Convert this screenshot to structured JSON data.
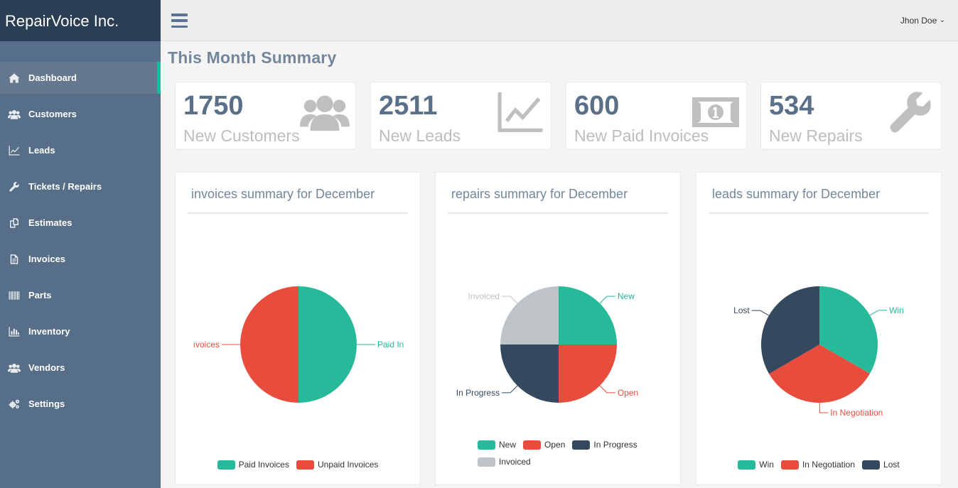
{
  "brand": "RepairVoice Inc.",
  "user": {
    "name": "Jhon Doe",
    "caret": "⌄"
  },
  "sidebar": {
    "items": [
      {
        "label": "Dashboard",
        "icon": "home-icon"
      },
      {
        "label": "Customers",
        "icon": "users-icon"
      },
      {
        "label": "Leads",
        "icon": "line-chart-icon"
      },
      {
        "label": "Tickets / Repairs",
        "icon": "wrench-icon"
      },
      {
        "label": "Estimates",
        "icon": "copy-icon"
      },
      {
        "label": "Invoices",
        "icon": "file-text-icon"
      },
      {
        "label": "Parts",
        "icon": "barcode-icon"
      },
      {
        "label": "Inventory",
        "icon": "bar-chart-icon"
      },
      {
        "label": "Vendors",
        "icon": "users-icon"
      },
      {
        "label": "Settings",
        "icon": "cogs-icon"
      }
    ]
  },
  "page": {
    "title": "This Month Summary"
  },
  "tiles": [
    {
      "count": "1750",
      "label": "New Customers",
      "icon": "users-icon"
    },
    {
      "count": "2511",
      "label": "New Leads",
      "icon": "line-chart-icon"
    },
    {
      "count": "600",
      "label": "New Paid Invoices",
      "icon": "money-icon"
    },
    {
      "count": "534",
      "label": "New Repairs",
      "icon": "wrench-icon"
    }
  ],
  "panels": [
    {
      "title": "invoices summary for December"
    },
    {
      "title": "repairs summary for December"
    },
    {
      "title": "leads summary for December"
    }
  ],
  "colors": {
    "green": "#26b99a",
    "red": "#e74c3c",
    "navy": "#34495e",
    "gray": "#bdc3c7",
    "accent": "#1abb9c"
  },
  "chart_data": [
    {
      "type": "pie",
      "title": "invoices summary for December",
      "slices": [
        {
          "label": "Paid Invoices",
          "value": 50,
          "color": "#26b99a",
          "callout": "Paid In"
        },
        {
          "label": "Unpaid Invoices",
          "value": 50,
          "color": "#e74c3c",
          "callout": "ıvoices"
        }
      ],
      "legend": "bottom"
    },
    {
      "type": "pie",
      "title": "repairs summary for December",
      "slices": [
        {
          "label": "New",
          "value": 25,
          "color": "#26b99a",
          "callout": "New"
        },
        {
          "label": "Open",
          "value": 25,
          "color": "#e74c3c",
          "callout": "Open"
        },
        {
          "label": "In Progress",
          "value": 25,
          "color": "#34495e",
          "callout": "In Progress"
        },
        {
          "label": "Invoiced",
          "value": 25,
          "color": "#bdc3c7",
          "callout": "Invoiced"
        }
      ],
      "legend": "bottom"
    },
    {
      "type": "pie",
      "title": "leads summary for December",
      "slices": [
        {
          "label": "Win",
          "value": 33.3,
          "color": "#26b99a",
          "callout": "Win"
        },
        {
          "label": "In Negotiation",
          "value": 33.3,
          "color": "#e74c3c",
          "callout": "In Negotiation"
        },
        {
          "label": "Lost",
          "value": 33.4,
          "color": "#34495e",
          "callout": "Lost"
        }
      ],
      "legend": "bottom"
    }
  ]
}
